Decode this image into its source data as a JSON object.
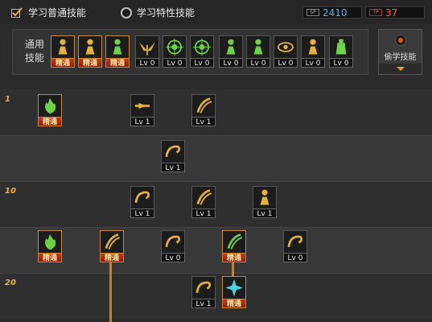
{
  "header": {
    "learn_normal": "学习普通技能",
    "learn_special": "学习特性技能",
    "sp_tag": "SP",
    "sp_value": "2410",
    "tp_tag": "TP",
    "tp_value": "37"
  },
  "common": {
    "label": "通用技能",
    "skills": [
      {
        "icon": "crouch-icon",
        "badge": "精通",
        "mastered": true,
        "color": "#e3b23c"
      },
      {
        "icon": "grapple-icon",
        "badge": "精通",
        "mastered": true,
        "color": "#e3b23c"
      },
      {
        "icon": "leap-icon",
        "badge": "精通",
        "mastered": true,
        "color": "#6fd04a"
      },
      {
        "icon": "wings-icon",
        "badge": "Lv 0",
        "mastered": false,
        "color": "#e3b23c"
      },
      {
        "icon": "target-icon",
        "badge": "Lv 0",
        "mastered": false,
        "color": "#6fd04a"
      },
      {
        "icon": "crosshair-icon",
        "badge": "Lv 0",
        "mastered": false,
        "color": "#6fd04a"
      },
      {
        "icon": "figure-icon",
        "badge": "Lv 0",
        "mastered": false,
        "color": "#6fd04a"
      },
      {
        "icon": "figure-shield-icon",
        "badge": "Lv 0",
        "mastered": false,
        "color": "#6fd04a"
      },
      {
        "icon": "eye-ring-icon",
        "badge": "Lv 0",
        "mastered": false,
        "color": "#e3b23c"
      },
      {
        "icon": "muscle-icon",
        "badge": "Lv 0",
        "mastered": false,
        "color": "#e3b23c"
      },
      {
        "icon": "potion-icon",
        "badge": "Lv 0",
        "mastered": false,
        "color": "#6fd04a"
      }
    ]
  },
  "steal": {
    "label": "偷学技能"
  },
  "levels": [
    "1",
    "10",
    "20"
  ],
  "tree_skills": [
    {
      "icon": "base-icon",
      "badge": "精通",
      "mastered": true,
      "color": "#6fd04a"
    },
    {
      "icon": "slash-icon",
      "badge": "Lv 1",
      "mastered": false,
      "color": "#e3b23c"
    },
    {
      "icon": "scythe-icon",
      "badge": "Lv 1",
      "mastered": false,
      "color": "#e3b23c"
    },
    {
      "icon": "spin-slash-icon",
      "badge": "Lv 1",
      "mastered": false,
      "color": "#e3b23c"
    },
    {
      "icon": "swirl-icon",
      "badge": "Lv 1",
      "mastered": false,
      "color": "#e3b23c"
    },
    {
      "icon": "triple-claw-icon",
      "badge": "Lv 1",
      "mastered": false,
      "color": "#e3b23c"
    },
    {
      "icon": "lunge-icon",
      "badge": "Lv 1",
      "mastered": false,
      "color": "#e3b23c"
    },
    {
      "icon": "green-flame-icon",
      "badge": "精通",
      "mastered": true,
      "color": "#6fd04a"
    },
    {
      "icon": "rising-strike-icon",
      "badge": "精通",
      "mastered": true,
      "color": "#e3b23c"
    },
    {
      "icon": "wave-slash-icon",
      "badge": "Lv 0",
      "mastered": false,
      "color": "#e3b23c"
    },
    {
      "icon": "green-claw-icon",
      "badge": "精通",
      "mastered": true,
      "color": "#6fd04a"
    },
    {
      "icon": "crescent-icon",
      "badge": "Lv 0",
      "mastered": false,
      "color": "#e3b23c"
    },
    {
      "icon": "arc-slash-icon",
      "badge": "Lv 1",
      "mastered": false,
      "color": "#e3b23c"
    },
    {
      "icon": "cyan-burst-icon",
      "badge": "精通",
      "mastered": true,
      "color": "#4fd0e0"
    }
  ]
}
